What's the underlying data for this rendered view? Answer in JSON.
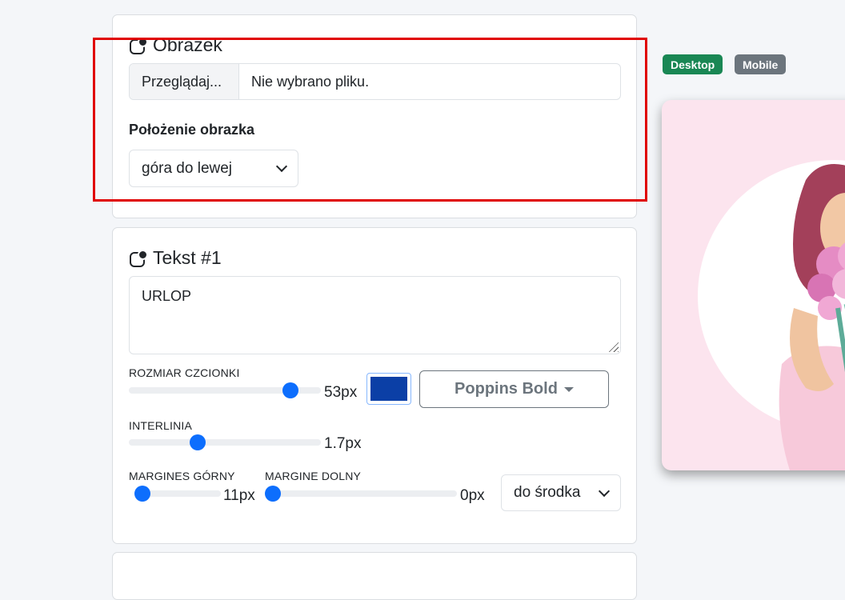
{
  "image_card": {
    "title": "Obrazek",
    "file_button": "Przeglądaj...",
    "file_name": "Nie wybrano pliku.",
    "position_label": "Położenie obrazka",
    "position_value": "góra do lewej"
  },
  "text_card": {
    "title": "Tekst #1",
    "text_value": "URLOP",
    "font_size_label": "ROZMIAR CZCIONKI",
    "font_size_value": "53px",
    "font_size_fraction": 0.84,
    "color": "#0b3fa6",
    "font_label": "Poppins Bold",
    "line_height_label": "INTERLINIA",
    "line_height_value": "1.7px",
    "line_height_fraction": 0.36,
    "margin_top_label": "MARGINES GÓRNY",
    "margin_top_value": "11px",
    "margin_top_fraction": 0.07,
    "margin_bottom_label": "MARGINE DOLNY",
    "margin_bottom_value": "0px",
    "margin_bottom_fraction": 0.0,
    "align_value": "do środka"
  },
  "view_toggle": {
    "desktop_label": "Desktop",
    "mobile_label": "Mobile",
    "desktop_color": "#198754",
    "mobile_color": "#6c757d"
  },
  "accent_color": "#0d6efd",
  "highlight_color": "#e00000"
}
